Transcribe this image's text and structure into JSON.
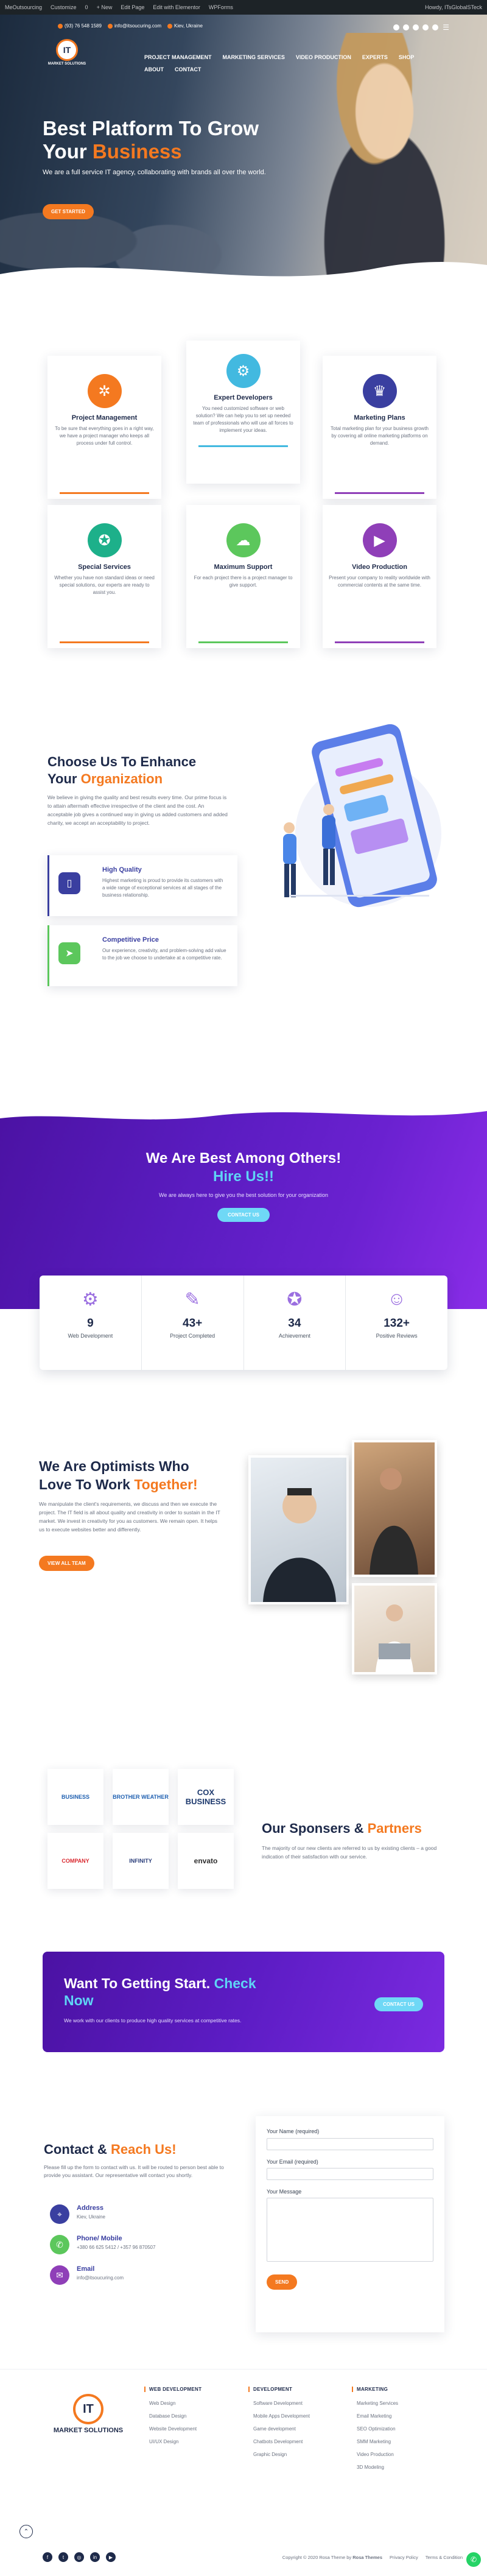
{
  "wp_bar": {
    "items": [
      "MeOutsourcing",
      "Customize",
      "0",
      "+ New",
      "Edit Page",
      "Edit with Elementor",
      "WPForms"
    ],
    "user": "Howdy, ITsGlobalSTeck"
  },
  "topbar": {
    "phone": "(93) 76 548 1589",
    "email": "info@itsoucuring.com",
    "location": "Kiev, Ukraine"
  },
  "nav": {
    "items": [
      "PROJECT MANAGEMENT",
      "MARKETING SERVICES",
      "VIDEO PRODUCTION",
      "EXPERTS",
      "SHOP",
      "ABOUT",
      "CONTACT"
    ]
  },
  "hero": {
    "title_line1": "Best Platform To Grow",
    "title_line2_plain": "Your",
    "title_line2_accent": "Business",
    "subtitle": "We are a full service IT agency, collaborating with brands all over the world.",
    "cta": "GET STARTED"
  },
  "services": [
    {
      "title": "Project Management",
      "text": "To be sure that everything goes in a right way, we have a project manager who keeps all process under full control.",
      "color": "#f47920",
      "icon": "gear-network-icon"
    },
    {
      "title": "Expert Developers",
      "text": "You need customized software or web solution? We can help you to set up needed team of professionals who will use all forces to implement your ideas.",
      "color": "#42b9e0",
      "icon": "developer-icon"
    },
    {
      "title": "Marketing Plans",
      "text": "Total marketing plan for your business growth by covering all online marketing platforms on demand.",
      "color": "#3a3fa0",
      "icon": "marketing-icon"
    },
    {
      "title": "Special Services",
      "text": "Whether you have non standard ideas or need special solutions, our experts are ready to assist you.",
      "color": "#1db08a",
      "icon": "award-icon"
    },
    {
      "title": "Maximum Support",
      "text": "For each project there is a project manager to give support.",
      "color": "#5cc75c",
      "icon": "support-icon"
    },
    {
      "title": "Video Production",
      "text": "Present your company to reality worldwide with commercial contents at the same time.",
      "color": "#8f3fb8",
      "icon": "video-icon"
    }
  ],
  "choose": {
    "title_line1": "Choose Us To Enhance",
    "title_plain": "Your",
    "title_accent": "Organization",
    "text": "We believe in giving the quality and best results every time. Our prime focus is to attain aftermath effective irrespective of the client and the cost. An acceptable job gives a continued way in giving us added customers and added charity, we accept an acceptability to project.",
    "features": [
      {
        "title": "High Quality",
        "text": "Highest marketing is proud to provide its customers with a wide range of exceptional services at all stages of the business relationship.",
        "color": "#3a3fa0"
      },
      {
        "title": "Competitive Price",
        "text": "Our experience, creativity, and problem-solving add value to the job we choose to undertake at a competitive rate.",
        "color": "#5cc75c"
      }
    ]
  },
  "stats_band": {
    "title_line1": "We Are Best Among Others!",
    "title_line2": "Hire Us!!",
    "text": "We are always here to give you the best solution for your organization",
    "cta": "CONTACT US",
    "stats": [
      {
        "value": "9",
        "label": "Web Development",
        "icon": "gears-icon"
      },
      {
        "value": "43+",
        "label": "Project Completed",
        "icon": "edit-icon"
      },
      {
        "value": "34",
        "label": "Achievement",
        "icon": "medal-icon"
      },
      {
        "value": "132+",
        "label": "Positive Reviews",
        "icon": "people-icon"
      }
    ]
  },
  "optimists": {
    "title_line1": "We Are Optimists Who",
    "title_plain": "Love To Work",
    "title_accent": "Together!",
    "text": "We manipulate the client's requirements, we discuss and then we execute the project. The IT field is all about quality and creativity in order to sustain in the IT market. We invest in creativity for you as customers. We remain open. It helps us to execute websites better and differently.",
    "cta": "VIEW ALL TEAM"
  },
  "sponsors": {
    "title_plain": "Our Sponsers &",
    "title_accent": "Partners",
    "text": "The majority of our new clients are referred to us by existing clients – a good indication of their satisfaction with our service.",
    "logos": [
      "BUSINESS",
      "BROTHER WEATHER",
      "COX BUSINESS",
      "COMPANY",
      "INFINITY",
      "envato"
    ]
  },
  "get_started": {
    "title_plain": "Want To Getting Start.",
    "title_accent_1": "Check",
    "title_accent_2": "Now",
    "text": "We work with our clients to produce high quality services at competitive rates.",
    "cta": "CONTACT US"
  },
  "contact": {
    "title_plain": "Contact &",
    "title_accent": "Reach Us!",
    "text": "Please fill up the form to contact with us. It will be routed to person best able to provide you assistant. Our representative will contact you shortly.",
    "address_label": "Address",
    "address_value": "Kiev, Ukraine",
    "phone_label": "Phone/ Mobile",
    "phone_value": "+380 66 625 5412 / +357 96 870507",
    "email_label": "Email",
    "email_value": "info@itsoucuring.com",
    "form": {
      "name_label": "Your Name (required)",
      "email_label": "Your Email (required)",
      "message_label": "Your Message",
      "send": "SEND"
    }
  },
  "footer": {
    "logo_text": "MARKET SOLUTIONS",
    "col1": {
      "title": "WEB DEVELOPMENT",
      "items": [
        "Web Design",
        "Database Design",
        "Website Development",
        "UI/UX Design"
      ]
    },
    "col2": {
      "title": "DEVELOPMENT",
      "items": [
        "Software Development",
        "Mobile Apps Development",
        "Game development",
        "Chatbots Development",
        "Graphic Design"
      ]
    },
    "col3": {
      "title": "MARKETING",
      "items": [
        "Marketing Services",
        "Email Marketing",
        "SEO Optimization",
        "SMM Marketing",
        "Video Production",
        "3D Modeling"
      ]
    },
    "copyright": "Copyright © 2020 Rosa Theme by",
    "copyright_brand": "Rosa Themes",
    "privacy": "Privacy Policy",
    "terms": "Terms & Condition"
  }
}
